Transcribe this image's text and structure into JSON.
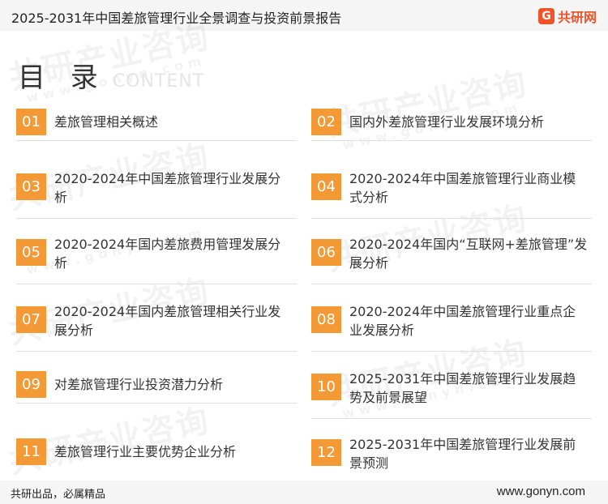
{
  "header": {
    "title": "2025-2031年中国差旅管理行业全景调查与投资前景报告",
    "brand_mark": "G",
    "brand_name": "共研网"
  },
  "watermark": {
    "text": "共研产业咨询",
    "domain": "www.gonyn.com"
  },
  "section": {
    "title": "目 录",
    "subtitle": "CONTENT"
  },
  "toc": [
    {
      "num": "01",
      "label": "差旅管理相关概述"
    },
    {
      "num": "02",
      "label": "国内外差旅管理行业发展环境分析"
    },
    {
      "num": "03",
      "label": "2020-2024年中国差旅管理行业发展分析"
    },
    {
      "num": "04",
      "label": "2020-2024年中国差旅管理行业商业模式分析"
    },
    {
      "num": "05",
      "label": "2020-2024年国内差旅费用管理发展分析"
    },
    {
      "num": "06",
      "label": "2020-2024年国内“互联网+差旅管理”发展分析"
    },
    {
      "num": "07",
      "label": "2020-2024年国内差旅管理相关行业发展分析"
    },
    {
      "num": "08",
      "label": "2020-2024年中国差旅管理行业重点企业发展分析"
    },
    {
      "num": "09",
      "label": "对差旅管理行业投资潜力分析"
    },
    {
      "num": "10",
      "label": "2025-2031年中国差旅管理行业发展趋势及前景展望"
    },
    {
      "num": "11",
      "label": "差旅管理行业主要优势企业分析"
    },
    {
      "num": "12",
      "label": "2025-2031年中国差旅管理行业发展前景预测"
    }
  ],
  "footer": {
    "slogan": "共研出品，必属精品",
    "url": "www.gonyn.com"
  },
  "colors": {
    "accent": "#f39a37",
    "brand": "#f0522a",
    "bar_background": "#f5f5f5"
  }
}
